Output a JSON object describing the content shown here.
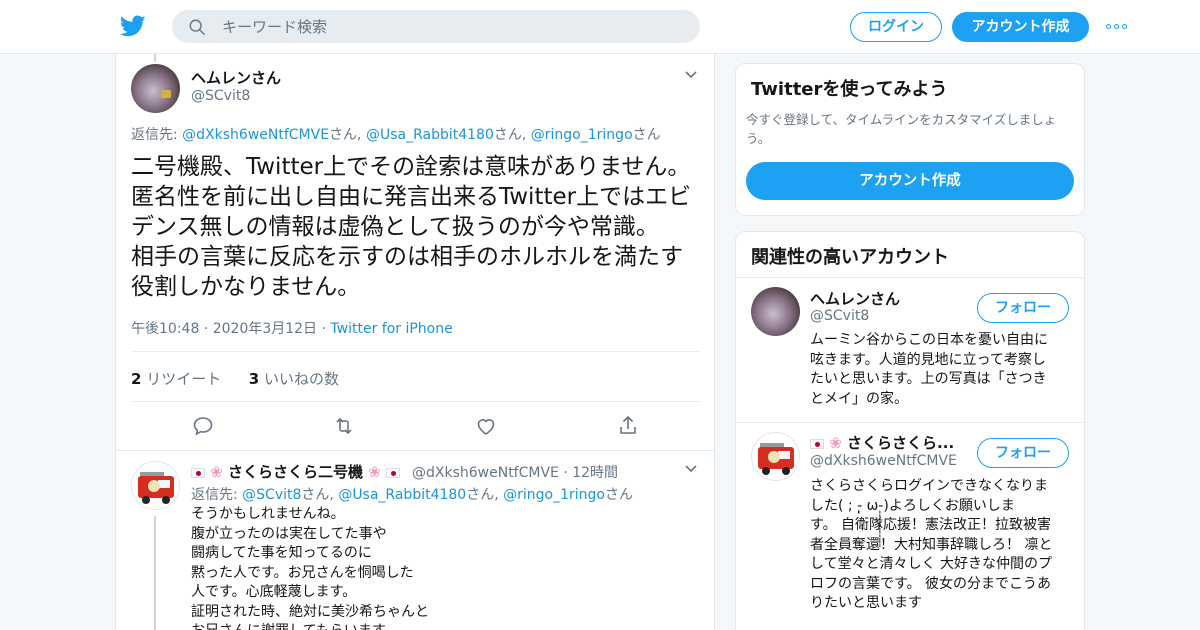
{
  "header": {
    "search_placeholder": "キーワード検索",
    "login_label": "ログイン",
    "signup_label": "アカウント作成"
  },
  "tweet": {
    "author_name": "ヘムレンさん",
    "author_handle": "@SCvit8",
    "reply_prefix": "返信先: ",
    "reply_to": [
      {
        "handle": "@dXksh6weNtfCMVE",
        "suffix": "さん, "
      },
      {
        "handle": "@Usa_Rabbit4180",
        "suffix": "さん, "
      },
      {
        "handle": "@ringo_1ringo",
        "suffix": "さん"
      }
    ],
    "text_lines": [
      "二号機殿、Twitter上でその詮索は意味がありません。",
      "匿名性を前に出し自由に発言出来るTwitter上ではエビ",
      "デンス無しの情報は虚偽として扱うのが今や常識。",
      "相手の言葉に反応を示すのは相手のホルホルを満たす",
      "役割しかなりません。"
    ],
    "timestamp": "午後10:48 · 2020年3月12日 · ",
    "source": "Twitter for iPhone",
    "retweet_count": "2",
    "retweet_label": " リツイート",
    "like_count": "3",
    "like_label": " いいねの数"
  },
  "reply": {
    "author_name": "さくらさくら二号機",
    "author_handle": "@dXksh6weNtfCMVE",
    "time": " · 12時間",
    "reply_prefix": "返信先: ",
    "reply_to": [
      {
        "handle": "@SCvit8",
        "suffix": "さん, "
      },
      {
        "handle": "@Usa_Rabbit4180",
        "suffix": "さん, "
      },
      {
        "handle": "@ringo_1ringo",
        "suffix": "さん"
      }
    ],
    "text_lines": [
      "そうかもしれませんね。",
      "腹が立ったのは実在してた事や",
      "闘病してた事を知ってるのに",
      "黙った人です。お兄さんを恫喝した",
      "人です。心底軽蔑します。",
      "証明された時、絶対に美沙希ちゃんと",
      "お兄さんに謝罪してもらいます"
    ]
  },
  "signup_card": {
    "title": "Twitterを使ってみよう",
    "desc_lines": [
      "今すぐ登録して、タイムラインをカスタマイズしましょ",
      "う。"
    ],
    "button_label": "アカウント作成"
  },
  "related": {
    "title": "関連性の高いアカウント",
    "follow_label": "フォロー",
    "accounts": [
      {
        "name": "ヘムレンさん",
        "handle": "@SCvit8",
        "bio_lines": [
          "ムーミン谷からこの日本を憂い自由に",
          "呟きます。人道的見地に立って考察し",
          "たいと思います。上の写真は「さつき",
          "とメイ」の家。"
        ]
      },
      {
        "name": "さくらさくら...",
        "handle": "@dXksh6weNtfCMVE",
        "bio_lines": [
          "さくらさくらログインできなくなりま",
          "した( ; -̩̩̩̩̩̩̩̩̩̩̩ ω-̩̩̩̩̩̩̩̩̩̩̩)よろしくお願いしま",
          "す。 自衛隊応援！憲法改正！拉致被害",
          "者全員奪還！大村知事辞職しろ！ 凛と",
          "して堂々と清々しく 大好きな仲間のプ",
          "ロフの言葉です。 彼女の分までこうあ",
          "りたいと思います"
        ]
      }
    ]
  },
  "colors": {
    "accent": "#1da1f2",
    "link": "#1b95e0",
    "muted": "#657786",
    "border": "#e1e8ed"
  }
}
